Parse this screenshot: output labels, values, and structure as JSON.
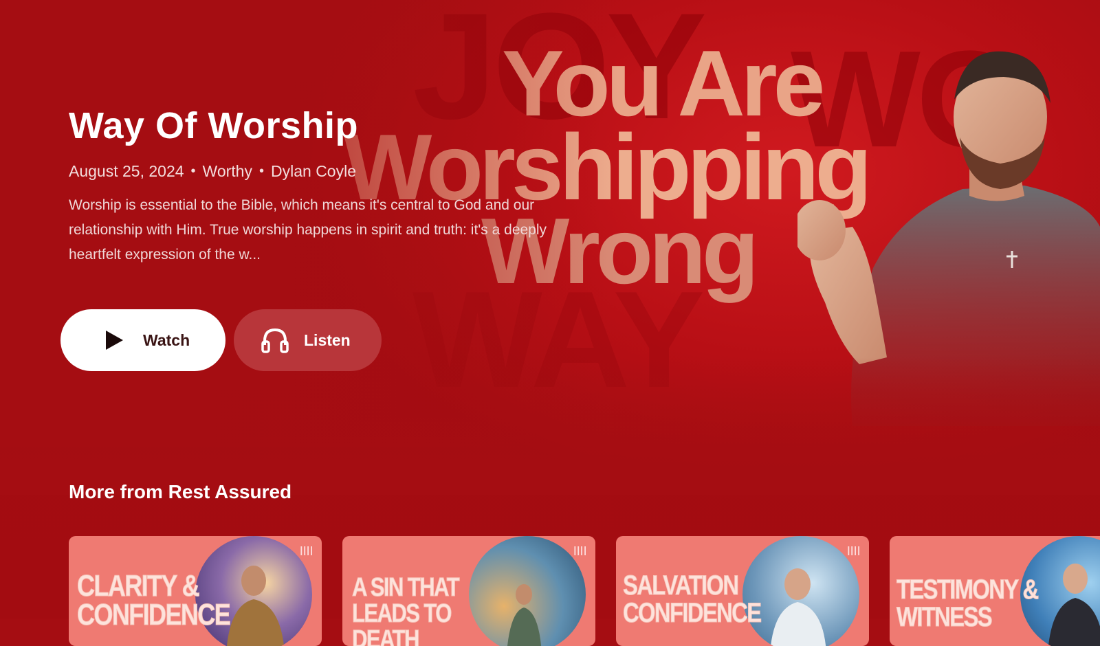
{
  "hero": {
    "art_lines": [
      "You Are",
      "Worshipping",
      "Wrong"
    ],
    "title": "Way Of Worship",
    "date": "August 25, 2024",
    "series": "Worthy",
    "speaker": "Dylan Coyle",
    "separator": "•",
    "description": "Worship is essential to the Bible, which means it's central to God and our relationship with Him. True worship happens in spirit and truth: it's a deeply heartfelt expression of the w...",
    "buttons": {
      "watch_label": "Watch",
      "watch_icon": "play-icon",
      "listen_label": "Listen",
      "listen_icon": "headphones-icon"
    }
  },
  "more": {
    "heading": "More from Rest Assured",
    "cards": [
      {
        "title_art": "CLARITY & CONFIDENCE"
      },
      {
        "title_art": "A SIN THAT LEADS TO DEATH"
      },
      {
        "title_art": "SALVATION CONFIDENCE"
      },
      {
        "title_art": "TESTIMONY & WITNESS"
      }
    ]
  },
  "colors": {
    "background": "#a50d12",
    "card": "#ef7a72",
    "button_primary": "#ffffff"
  }
}
